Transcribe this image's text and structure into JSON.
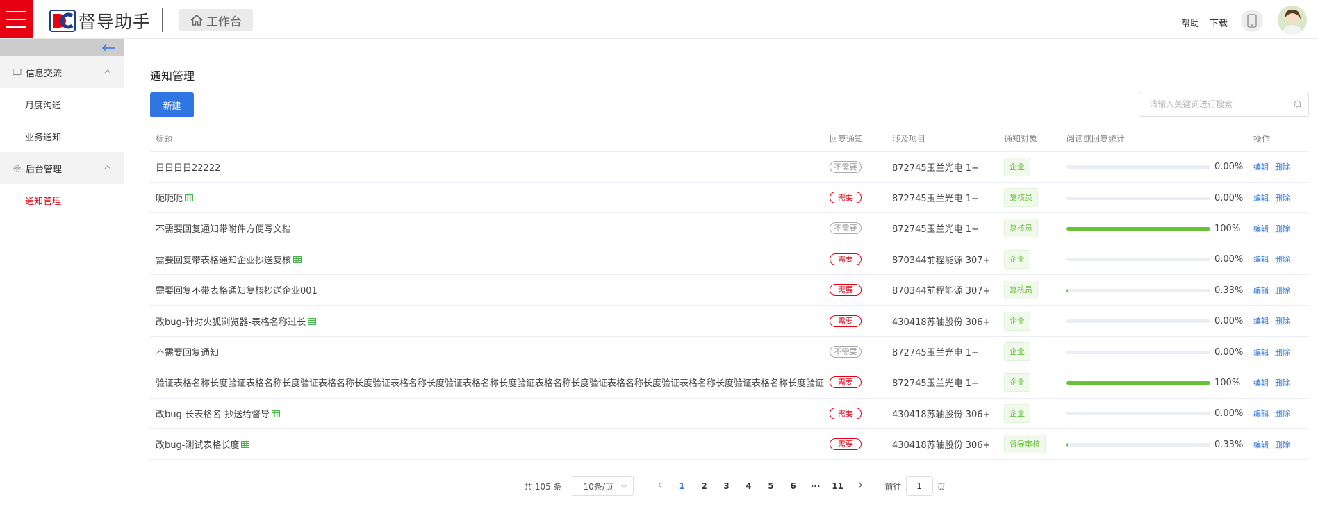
{
  "header": {
    "app_name": "督导助手",
    "workbench_label": "工作台",
    "help_label": "帮助",
    "download_label": "下载",
    "brand_color": "#e60012"
  },
  "sidebar": {
    "groups": [
      {
        "label": "信息交流",
        "icon": "message-icon",
        "items": [
          {
            "label": "月度沟通"
          },
          {
            "label": "业务通知"
          }
        ]
      },
      {
        "label": "后台管理",
        "icon": "gear-icon",
        "items": [
          {
            "label": "通知管理",
            "active": true
          }
        ]
      }
    ]
  },
  "main": {
    "title": "通知管理",
    "new_button": "新建",
    "search_placeholder": "请输入关键词进行搜索",
    "columns": [
      "标题",
      "回复通知",
      "涉及项目",
      "通知对象",
      "阅读或回复统计",
      "操作"
    ],
    "rows": [
      {
        "title": "日日日日22222",
        "has_sheet": false,
        "reply": "不需要",
        "reply_required": false,
        "project": "872745玉兰光电 1+",
        "target": "企业",
        "progress": 0.0,
        "percent": "0.00%"
      },
      {
        "title": "呃呃呃",
        "has_sheet": true,
        "reply": "需要",
        "reply_required": true,
        "project": "872745玉兰光电 1+",
        "target": "复核员",
        "progress": 0.0,
        "percent": "0.00%"
      },
      {
        "title": "不需要回复通知带附件方便写文档",
        "has_sheet": false,
        "reply": "不需要",
        "reply_required": false,
        "project": "872745玉兰光电 1+",
        "target": "复核员",
        "progress": 1.0,
        "percent": "100%"
      },
      {
        "title": "需要回复带表格通知企业抄送复核",
        "has_sheet": true,
        "reply": "需要",
        "reply_required": true,
        "project": "870344前程能源 307+",
        "target": "企业",
        "progress": 0.0,
        "percent": "0.00%"
      },
      {
        "title": "需要回复不带表格通知复核抄送企业001",
        "has_sheet": false,
        "reply": "需要",
        "reply_required": true,
        "project": "870344前程能源 307+",
        "target": "复核员",
        "progress": 0.0033,
        "percent": "0.33%"
      },
      {
        "title": "改bug-针对火狐浏览器-表格名称过长",
        "has_sheet": true,
        "reply": "需要",
        "reply_required": true,
        "project": "430418苏轴股份 306+",
        "target": "企业",
        "progress": 0.0,
        "percent": "0.00%"
      },
      {
        "title": "不需要回复通知",
        "has_sheet": false,
        "reply": "不需要",
        "reply_required": false,
        "project": "872745玉兰光电 1+",
        "target": "企业",
        "progress": 0.0,
        "percent": "0.00%"
      },
      {
        "title": "验证表格名称长度验证表格名称长度验证表格名称长度验证表格名称长度验证表格名称长度验证表格名称长度验证表格名称长度验证表格名称长度验证表格名称长度验证表格",
        "has_sheet": false,
        "reply": "需要",
        "reply_required": true,
        "project": "872745玉兰光电 1+",
        "target": "企业",
        "progress": 1.0,
        "percent": "100%"
      },
      {
        "title": "改bug-长表格名-抄送给督导",
        "has_sheet": true,
        "reply": "需要",
        "reply_required": true,
        "project": "430418苏轴股份 306+",
        "target": "企业",
        "progress": 0.0,
        "percent": "0.00%"
      },
      {
        "title": "改bug-测试表格长度",
        "has_sheet": true,
        "reply": "需要",
        "reply_required": true,
        "project": "430418苏轴股份 306+",
        "target": "督导审核",
        "progress": 0.0033,
        "percent": "0.33%"
      }
    ],
    "actions": {
      "edit": "编辑",
      "delete": "删除"
    }
  },
  "pagination": {
    "total_text": "共 105 条",
    "page_size": "10条/页",
    "pages": [
      "1",
      "2",
      "3",
      "4",
      "5",
      "6",
      "···",
      "11"
    ],
    "current_page": "1",
    "goto_prefix": "前往",
    "goto_value": "1",
    "goto_suffix": "页"
  }
}
